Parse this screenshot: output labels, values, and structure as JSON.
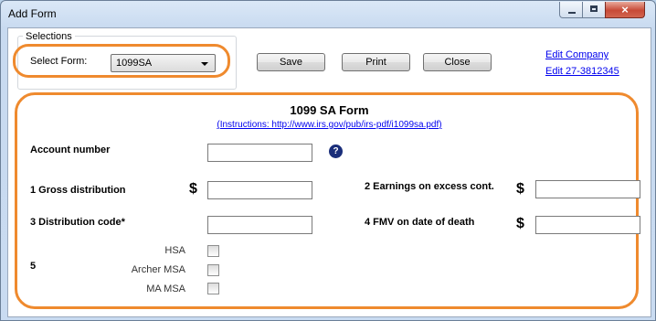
{
  "window": {
    "title": "Add Form",
    "close_glyph": "×"
  },
  "selections": {
    "group_label": "Selections",
    "select_label": "Select Form:",
    "select_value": "1099SA"
  },
  "toolbar": {
    "save_label": "Save",
    "print_label": "Print",
    "close_label": "Close"
  },
  "links": {
    "edit_company": "Edit Company",
    "edit_id": "Edit 27-3812345"
  },
  "form": {
    "title": "1099 SA Form",
    "instructions": "(Instructions: http://www.irs.gov/pub/irs-pdf/i1099sa.pdf)",
    "account_label": "Account number",
    "account_value": "",
    "help_glyph": "?",
    "gross_label": "1 Gross distribution",
    "gross_value": "",
    "earnings_label": "2 Earnings on excess cont.",
    "earnings_value": "",
    "code_label": "3 Distribution code*",
    "code_value": "",
    "fmv_label": "4 FMV on date of death",
    "fmv_value": "",
    "dollar": "$",
    "box5_label": "5",
    "checkboxes": [
      {
        "label": "HSA",
        "checked": false
      },
      {
        "label": "Archer MSA",
        "checked": false
      },
      {
        "label": "MA MSA",
        "checked": false
      }
    ]
  },
  "colors": {
    "highlight": "#ef8a2e",
    "link": "#0000ee",
    "help_icon": "#1a2e7a"
  }
}
